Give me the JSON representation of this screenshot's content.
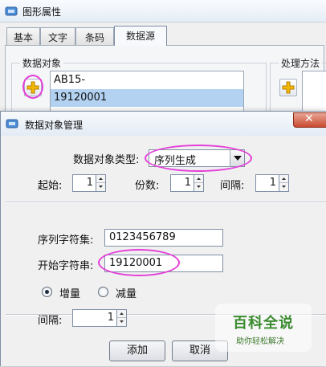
{
  "back_window": {
    "title": "图形属性",
    "tabs": [
      {
        "label": "基本"
      },
      {
        "label": "文字"
      },
      {
        "label": "条码"
      },
      {
        "label": "数据源"
      }
    ],
    "active_tab": "数据源",
    "data_object_group": {
      "title": "数据对象",
      "items": [
        "AB15-",
        "19120001"
      ],
      "selected_index": 1
    },
    "processing_group": {
      "title": "处理方法"
    }
  },
  "dialog": {
    "title": "数据对象管理",
    "close_symbol": "✕",
    "type_label": "数据对象类型:",
    "type_value": "序列生成",
    "start": {
      "label": "起始:",
      "value": "1"
    },
    "copies": {
      "label": "份数:",
      "value": "1"
    },
    "interval_top": {
      "label": "间隔:",
      "value": "1"
    },
    "charset": {
      "label": "序列字符集:",
      "value": "0123456789"
    },
    "start_string": {
      "label": "开始字符串:",
      "value": "19120001"
    },
    "increment": {
      "label": "增量",
      "selected": true
    },
    "decrement": {
      "label": "减量",
      "selected": false
    },
    "interval_bottom": {
      "label": "间隔:",
      "value": "1"
    },
    "add_button": "添加",
    "cancel_button": "取消"
  },
  "watermark": {
    "title": "百科全说",
    "subtitle": "助你轻松解决"
  },
  "colors": {
    "highlight_ellipse": "#e43fd9",
    "selection": "#b3d2f2",
    "close_button": "#c94a30",
    "plus_icon": "#f2b705"
  },
  "icons": [
    "app-icon",
    "plus-icon",
    "close-icon",
    "dropdown-arrow-icon",
    "spin-up-icon",
    "spin-down-icon"
  ]
}
